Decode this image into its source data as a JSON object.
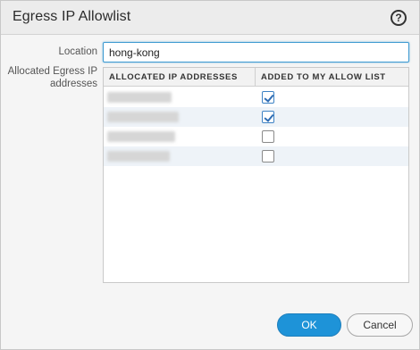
{
  "dialog": {
    "title": "Egress IP Allowlist",
    "help_icon": "question-mark-icon"
  },
  "form": {
    "location_label": "Location",
    "location_value": "hong-kong",
    "allocated_label": "Allocated Egress IP addresses"
  },
  "table": {
    "headers": [
      "ALLOCATED IP ADDRESSES",
      "ADDED TO MY ALLOW LIST"
    ],
    "rows": [
      {
        "ip": "",
        "added": true
      },
      {
        "ip": "",
        "added": true
      },
      {
        "ip": "",
        "added": false
      },
      {
        "ip": "",
        "added": false
      }
    ]
  },
  "buttons": {
    "ok": "OK",
    "cancel": "Cancel"
  },
  "colors": {
    "accent": "#1e93d8",
    "checkmark": "#2f6db4"
  }
}
